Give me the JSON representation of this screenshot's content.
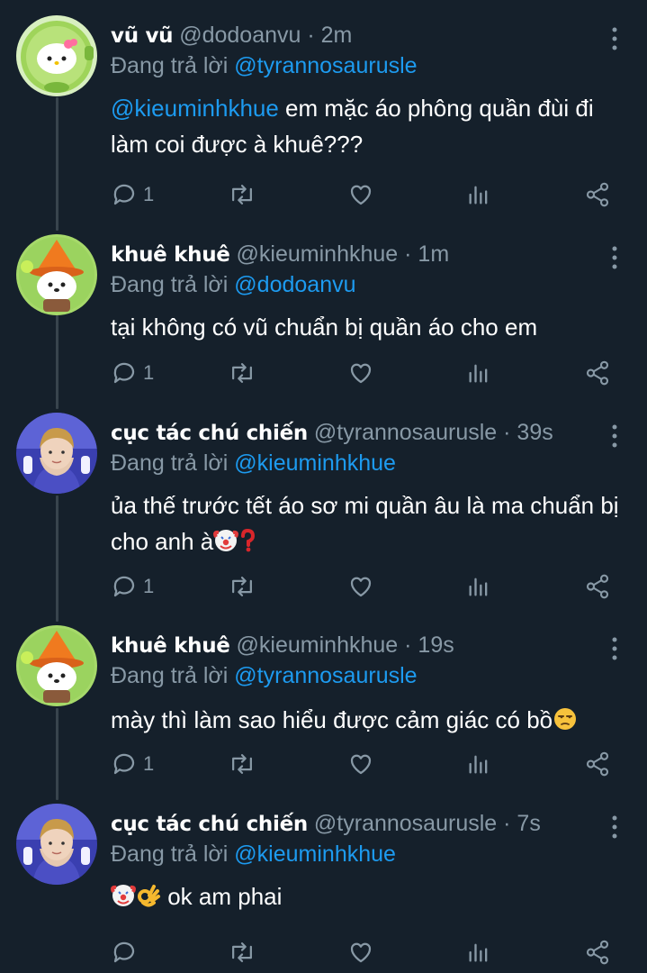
{
  "reply_prefix": "Đang trả lời",
  "tweets": [
    {
      "display_name": "vũ vũ",
      "handle": "@dodoanvu",
      "time": "2m",
      "reply_to": "@tyrannosaurusle",
      "mention": "@kieuminhkhue",
      "text": " em mặc áo phông quần đùi đi làm coi được à khuê???",
      "reply_count": "1",
      "avatar": "hello-kitty-peashooter-avatar"
    },
    {
      "display_name": "khuê khuê",
      "handle": "@kieuminhkhue",
      "time": "1m",
      "reply_to": "@dodoanvu",
      "text": "tại không có vũ chuẩn bị quần áo cho em",
      "reply_count": "1",
      "avatar": "pochacco-orange-hat-avatar"
    },
    {
      "display_name": "cục tác chú chiến",
      "handle": "@tyrannosaurusle",
      "time": "39s",
      "reply_to": "@kieuminhkhue",
      "text": "ủa thế trước tết áo sơ mi quần âu là ma chuẩn bị cho anh à",
      "emoji": [
        "clown-face",
        "red-question-mark"
      ],
      "reply_count": "1",
      "avatar": "person-photo-avatar"
    },
    {
      "display_name": "khuê khuê",
      "handle": "@kieuminhkhue",
      "time": "19s",
      "reply_to": "@tyrannosaurusle",
      "text": "mày thì làm sao hiểu được cảm giác có bồ",
      "emoji": [
        "unamused-face"
      ],
      "reply_count": "1",
      "avatar": "pochacco-orange-hat-avatar"
    },
    {
      "display_name": "cục tác chú chiến",
      "handle": "@tyrannosaurusle",
      "time": "7s",
      "reply_to": "@kieuminhkhue",
      "text": " ok am phai",
      "emoji": [
        "clown-face",
        "ok-hand"
      ],
      "reply_count": "",
      "avatar": "person-photo-avatar"
    }
  ],
  "icons": {
    "reply": "reply-icon",
    "retweet": "retweet-icon",
    "like": "like-icon",
    "views": "views-icon",
    "share": "share-icon",
    "more": "more-icon"
  },
  "colors": {
    "background": "#15202b",
    "secondary_text": "#8899a6",
    "link": "#1d9bf0",
    "thread_line": "#38444d"
  }
}
